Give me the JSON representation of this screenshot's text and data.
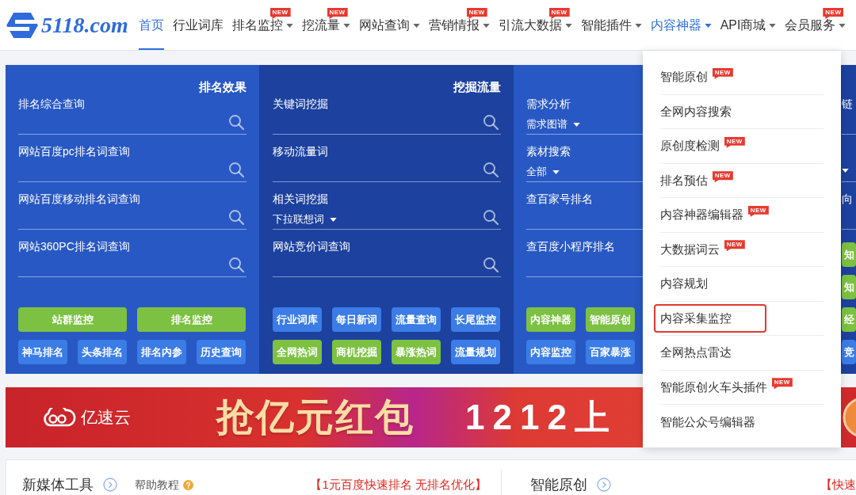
{
  "header": {
    "logo": {
      "text": "5118.com"
    },
    "nav": [
      {
        "label": "首页",
        "selected": true,
        "expanded": false,
        "has_menu": false
      },
      {
        "label": "行业词库",
        "selected": false,
        "expanded": false,
        "has_menu": false
      },
      {
        "label": "排名监控",
        "selected": false,
        "expanded": false,
        "has_menu": true,
        "badge": "NEW"
      },
      {
        "label": "挖流量",
        "selected": false,
        "expanded": false,
        "has_menu": true,
        "badge": "NEW"
      },
      {
        "label": "网站查询",
        "selected": false,
        "expanded": false,
        "has_menu": true
      },
      {
        "label": "营销情报",
        "selected": false,
        "expanded": false,
        "has_menu": true,
        "badge": "NEW"
      },
      {
        "label": "引流大数据",
        "selected": false,
        "expanded": false,
        "has_menu": true,
        "badge": "NEW"
      },
      {
        "label": "智能插件",
        "selected": false,
        "expanded": false,
        "has_menu": true
      },
      {
        "label": "内容神器",
        "selected": false,
        "expanded": true,
        "has_menu": true,
        "menu": {
          "items": [
            {
              "label": "智能原创",
              "badge": "NEW",
              "highlighted": false
            },
            {
              "label": "全网内容搜索",
              "highlighted": false
            },
            {
              "label": "原创度检测",
              "badge": "NEW",
              "highlighted": false
            },
            {
              "label": "排名预估",
              "badge": "NEW",
              "highlighted": false
            },
            {
              "label": "内容神器编辑器",
              "badge": "NEW",
              "highlighted": false
            },
            {
              "label": "大数据词云",
              "badge": "NEW",
              "highlighted": false
            },
            {
              "label": "内容规划",
              "highlighted": false
            },
            {
              "label": "内容采集监控",
              "highlighted": true
            },
            {
              "label": "全网热点雷达",
              "highlighted": false
            },
            {
              "label": "智能原创火车头插件",
              "badge": "NEW",
              "highlighted": false
            },
            {
              "label": "智能公众号编辑器",
              "highlighted": false
            }
          ]
        }
      },
      {
        "label": "API商城",
        "selected": false,
        "expanded": false,
        "has_menu": true
      },
      {
        "label": "会员服务",
        "selected": false,
        "expanded": false,
        "has_menu": true,
        "badge": "NEW"
      }
    ]
  },
  "tool_panel": {
    "columns": [
      {
        "title": "排名效果",
        "fields": [
          {
            "label": "排名综合查询",
            "search": true
          },
          {
            "label": "网站百度pc排名词查询",
            "search": true
          },
          {
            "label": "网站百度移动排名词查询",
            "search": true
          },
          {
            "label": "网站360PC排名词查询",
            "search": true
          }
        ],
        "button_rows": [
          [
            {
              "label": "站群监控",
              "kind": "wide",
              "color": "#7cc142"
            },
            {
              "label": "排名监控",
              "kind": "wide",
              "color": "#7cc142"
            }
          ],
          [
            {
              "label": "神马排名",
              "kind": "normal",
              "color": "#3b7ce6"
            },
            {
              "label": "头条排名",
              "kind": "normal",
              "color": "#3b7ce6"
            },
            {
              "label": "排名内参",
              "kind": "normal",
              "color": "#3b7ce6"
            },
            {
              "label": "历史查询",
              "kind": "normal",
              "color": "#3b7ce6"
            }
          ]
        ]
      },
      {
        "title": "挖掘流量",
        "fields": [
          {
            "label": "关键词挖掘",
            "search": true
          },
          {
            "label": "移动流量词",
            "search": true
          },
          {
            "label": "相关词挖掘",
            "dropdown": true,
            "option": "下拉联想词",
            "search": true
          },
          {
            "label": "网站竞价词查询",
            "search": true
          }
        ],
        "button_rows": [
          [
            {
              "label": "行业词库",
              "kind": "normal",
              "color": "#3b7ce6"
            },
            {
              "label": "每日新词",
              "kind": "normal",
              "color": "#3b7ce6"
            },
            {
              "label": "流量查询",
              "kind": "normal",
              "color": "#3b7ce6"
            },
            {
              "label": "长尾监控",
              "kind": "normal",
              "color": "#3b7ce6"
            }
          ],
          [
            {
              "label": "全网热词",
              "kind": "normal",
              "color": "#7cc142"
            },
            {
              "label": "商机挖掘",
              "kind": "normal",
              "color": "#7cc142"
            },
            {
              "label": "暴涨热词",
              "kind": "normal",
              "color": "#7cc142"
            },
            {
              "label": "流量规划",
              "kind": "normal",
              "color": "#3b7ce6"
            }
          ]
        ]
      },
      {
        "fields": [
          {
            "label": "需求分析",
            "dropdown": true,
            "option": "需求图谱"
          },
          {
            "label": "素材搜索",
            "dropdown": true,
            "option": "全部"
          },
          {
            "label": "查百家号排名"
          },
          {
            "label": "查百度小程序排名"
          }
        ],
        "button_rows": [
          [
            {
              "label": "内容神器",
              "kind": "normal",
              "color": "#7cc142"
            },
            {
              "label": "智能原创",
              "kind": "normal",
              "color": "#7cc142"
            }
          ],
          [
            {
              "label": "内容监控",
              "kind": "normal",
              "color": "#3b7ce6"
            },
            {
              "label": "百家暴涨",
              "kind": "normal",
              "color": "#3b7ce6"
            }
          ]
        ]
      },
      {
        "fields": [
          {
            "label": "链"
          },
          {
            "dropdown": true
          },
          {
            "label": "向"
          }
        ],
        "button_rows": [
          [
            {
              "label": "知",
              "kind": "normal",
              "color": "#7cc142"
            }
          ],
          [
            {
              "label": "知",
              "kind": "normal",
              "color": "#7cc142"
            }
          ],
          [
            {
              "label": "经",
              "kind": "normal",
              "color": "#7cc142"
            }
          ],
          [
            {
              "label": "竞",
              "kind": "normal",
              "color": "#3b7ce6"
            }
          ]
        ]
      }
    ]
  },
  "banner": {
    "brand": "亿速云",
    "headline": "抢亿元红包",
    "promo": "1212上"
  },
  "bottom_card": {
    "sections": [
      {
        "title": "新媒体工具",
        "help": "帮助教程",
        "promo": "【1元百度快速排名 无排名优化】"
      },
      {
        "title": "智能原创",
        "promo": "【快速"
      }
    ]
  }
}
